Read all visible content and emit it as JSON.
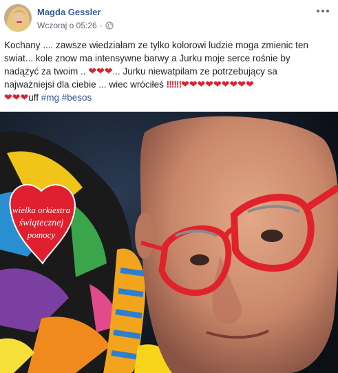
{
  "post": {
    "author": "Magda Gessler",
    "timestamp": "Wczoraj o 05:26",
    "separator": "·",
    "privacy_icon": "globe-icon",
    "more_icon": "more-options-icon",
    "text_lines": [
      "Kochany .... zawsze wiedziałam ze tylko kolorowi ludzie moga zmienic ten",
      "swiat... kole znow ma intensywne barwy a Jurku moje serce rośnie by",
      "nadążyć za twoim ..",
      "... Jurku niewatpilam ze potrzebujący sa",
      "najważniejsi dla ciebie ... wiec wróciłeś",
      "uff"
    ],
    "hashtags": [
      "#mg",
      "#besos"
    ],
    "badge_lines": [
      "wielka orkiestra",
      "świątecznej",
      "pomocy"
    ]
  },
  "colors": {
    "author_link": "#385898",
    "heart_red": "#e0202e",
    "glasses_red": "#e0232b"
  }
}
